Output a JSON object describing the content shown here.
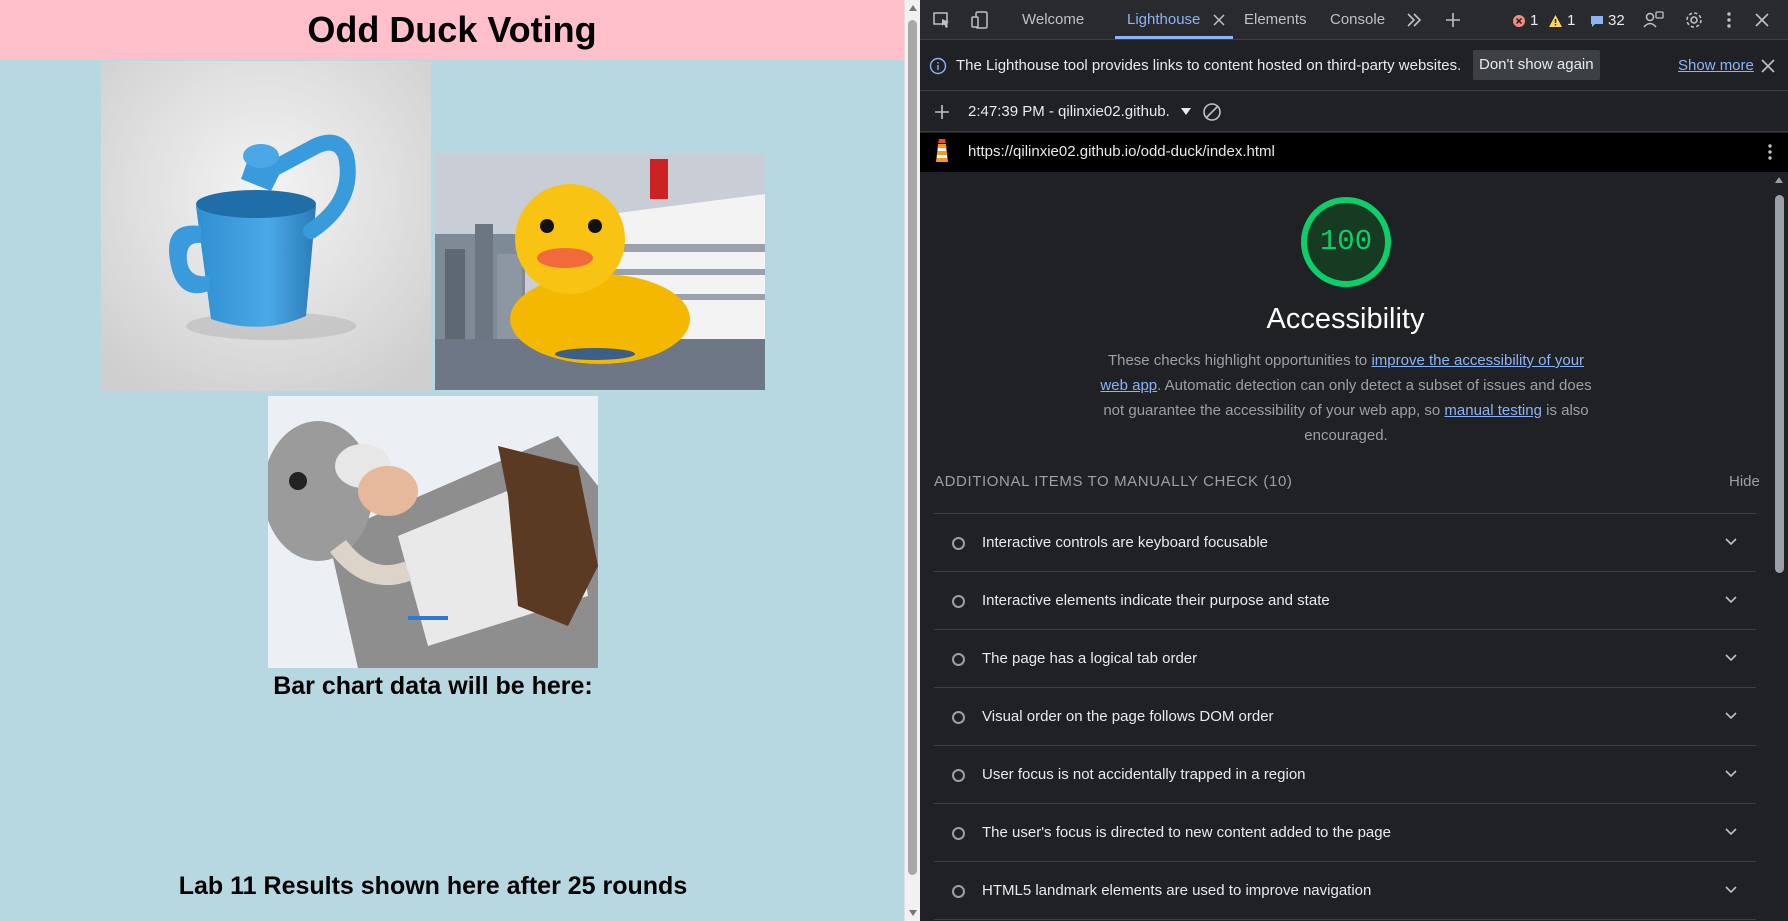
{
  "page": {
    "title": "Odd Duck Voting",
    "images": [
      {
        "name": "water-can",
        "alt": "water can"
      },
      {
        "name": "rubber-duck",
        "alt": "rubber duck"
      },
      {
        "name": "tauntaun",
        "alt": "tauntaun"
      }
    ],
    "chart_heading": "Bar chart data will be here:",
    "results_heading": "Lab 11 Results shown here after 25 rounds",
    "colors": {
      "header_bg": "#ffc0cb",
      "body_bg": "#b7d7e1"
    }
  },
  "devtools": {
    "tabs": [
      {
        "label": "Welcome"
      },
      {
        "label": "Lighthouse",
        "active": true
      },
      {
        "label": "Elements"
      },
      {
        "label": "Console"
      }
    ],
    "counts": {
      "errors": "1",
      "warnings": "1",
      "info": "32"
    },
    "infobar": {
      "message": "The Lighthouse tool provides links to content hosted on third-party websites.",
      "dismiss_label": "Don't show again",
      "show_more_label": "Show more"
    },
    "report_select": "2:47:39 PM - qilinxie02.github.",
    "url": "https://qilinxie02.github.io/odd-duck/index.html",
    "report": {
      "score": "100",
      "score_fraction": 1.0,
      "category_title": "Accessibility",
      "desc_before": "These checks highlight opportunities to ",
      "desc_link1": "improve the accessibility of your web app",
      "desc_middle": ". Automatic detection can only detect a subset of issues and does not guarantee the accessibility of your web app, so ",
      "desc_link2": "manual testing",
      "desc_after": " is also encouraged.",
      "manual_header": "ADDITIONAL ITEMS TO MANUALLY CHECK (10)",
      "hide_label": "Hide",
      "audits": [
        "Interactive controls are keyboard focusable",
        "Interactive elements indicate their purpose and state",
        "The page has a logical tab order",
        "Visual order on the page follows DOM order",
        "User focus is not accidentally trapped in a region",
        "The user's focus is directed to new content added to the page",
        "HTML5 landmark elements are used to improve navigation"
      ]
    },
    "colors": {
      "accent": "#8ab4f8",
      "pass": "#0cce6b",
      "bg": "#202124"
    }
  }
}
